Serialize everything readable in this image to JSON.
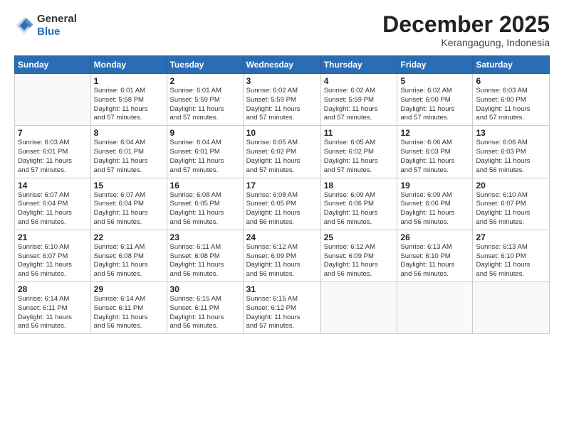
{
  "header": {
    "logo_general": "General",
    "logo_blue": "Blue",
    "month": "December 2025",
    "location": "Kerangagung, Indonesia"
  },
  "weekdays": [
    "Sunday",
    "Monday",
    "Tuesday",
    "Wednesday",
    "Thursday",
    "Friday",
    "Saturday"
  ],
  "weeks": [
    [
      {
        "day": "",
        "info": ""
      },
      {
        "day": "1",
        "info": "Sunrise: 6:01 AM\nSunset: 5:58 PM\nDaylight: 11 hours\nand 57 minutes."
      },
      {
        "day": "2",
        "info": "Sunrise: 6:01 AM\nSunset: 5:59 PM\nDaylight: 11 hours\nand 57 minutes."
      },
      {
        "day": "3",
        "info": "Sunrise: 6:02 AM\nSunset: 5:59 PM\nDaylight: 11 hours\nand 57 minutes."
      },
      {
        "day": "4",
        "info": "Sunrise: 6:02 AM\nSunset: 5:59 PM\nDaylight: 11 hours\nand 57 minutes."
      },
      {
        "day": "5",
        "info": "Sunrise: 6:02 AM\nSunset: 6:00 PM\nDaylight: 11 hours\nand 57 minutes."
      },
      {
        "day": "6",
        "info": "Sunrise: 6:03 AM\nSunset: 6:00 PM\nDaylight: 11 hours\nand 57 minutes."
      }
    ],
    [
      {
        "day": "7",
        "info": "Sunrise: 6:03 AM\nSunset: 6:01 PM\nDaylight: 11 hours\nand 57 minutes."
      },
      {
        "day": "8",
        "info": "Sunrise: 6:04 AM\nSunset: 6:01 PM\nDaylight: 11 hours\nand 57 minutes."
      },
      {
        "day": "9",
        "info": "Sunrise: 6:04 AM\nSunset: 6:01 PM\nDaylight: 11 hours\nand 57 minutes."
      },
      {
        "day": "10",
        "info": "Sunrise: 6:05 AM\nSunset: 6:02 PM\nDaylight: 11 hours\nand 57 minutes."
      },
      {
        "day": "11",
        "info": "Sunrise: 6:05 AM\nSunset: 6:02 PM\nDaylight: 11 hours\nand 57 minutes."
      },
      {
        "day": "12",
        "info": "Sunrise: 6:06 AM\nSunset: 6:03 PM\nDaylight: 11 hours\nand 57 minutes."
      },
      {
        "day": "13",
        "info": "Sunrise: 6:06 AM\nSunset: 6:03 PM\nDaylight: 11 hours\nand 56 minutes."
      }
    ],
    [
      {
        "day": "14",
        "info": "Sunrise: 6:07 AM\nSunset: 6:04 PM\nDaylight: 11 hours\nand 56 minutes."
      },
      {
        "day": "15",
        "info": "Sunrise: 6:07 AM\nSunset: 6:04 PM\nDaylight: 11 hours\nand 56 minutes."
      },
      {
        "day": "16",
        "info": "Sunrise: 6:08 AM\nSunset: 6:05 PM\nDaylight: 11 hours\nand 56 minutes."
      },
      {
        "day": "17",
        "info": "Sunrise: 6:08 AM\nSunset: 6:05 PM\nDaylight: 11 hours\nand 56 minutes."
      },
      {
        "day": "18",
        "info": "Sunrise: 6:09 AM\nSunset: 6:06 PM\nDaylight: 11 hours\nand 56 minutes."
      },
      {
        "day": "19",
        "info": "Sunrise: 6:09 AM\nSunset: 6:06 PM\nDaylight: 11 hours\nand 56 minutes."
      },
      {
        "day": "20",
        "info": "Sunrise: 6:10 AM\nSunset: 6:07 PM\nDaylight: 11 hours\nand 56 minutes."
      }
    ],
    [
      {
        "day": "21",
        "info": "Sunrise: 6:10 AM\nSunset: 6:07 PM\nDaylight: 11 hours\nand 56 minutes."
      },
      {
        "day": "22",
        "info": "Sunrise: 6:11 AM\nSunset: 6:08 PM\nDaylight: 11 hours\nand 56 minutes."
      },
      {
        "day": "23",
        "info": "Sunrise: 6:11 AM\nSunset: 6:08 PM\nDaylight: 11 hours\nand 56 minutes."
      },
      {
        "day": "24",
        "info": "Sunrise: 6:12 AM\nSunset: 6:09 PM\nDaylight: 11 hours\nand 56 minutes."
      },
      {
        "day": "25",
        "info": "Sunrise: 6:12 AM\nSunset: 6:09 PM\nDaylight: 11 hours\nand 56 minutes."
      },
      {
        "day": "26",
        "info": "Sunrise: 6:13 AM\nSunset: 6:10 PM\nDaylight: 11 hours\nand 56 minutes."
      },
      {
        "day": "27",
        "info": "Sunrise: 6:13 AM\nSunset: 6:10 PM\nDaylight: 11 hours\nand 56 minutes."
      }
    ],
    [
      {
        "day": "28",
        "info": "Sunrise: 6:14 AM\nSunset: 6:11 PM\nDaylight: 11 hours\nand 56 minutes."
      },
      {
        "day": "29",
        "info": "Sunrise: 6:14 AM\nSunset: 6:11 PM\nDaylight: 11 hours\nand 56 minutes."
      },
      {
        "day": "30",
        "info": "Sunrise: 6:15 AM\nSunset: 6:11 PM\nDaylight: 11 hours\nand 56 minutes."
      },
      {
        "day": "31",
        "info": "Sunrise: 6:15 AM\nSunset: 6:12 PM\nDaylight: 11 hours\nand 57 minutes."
      },
      {
        "day": "",
        "info": ""
      },
      {
        "day": "",
        "info": ""
      },
      {
        "day": "",
        "info": ""
      }
    ]
  ]
}
